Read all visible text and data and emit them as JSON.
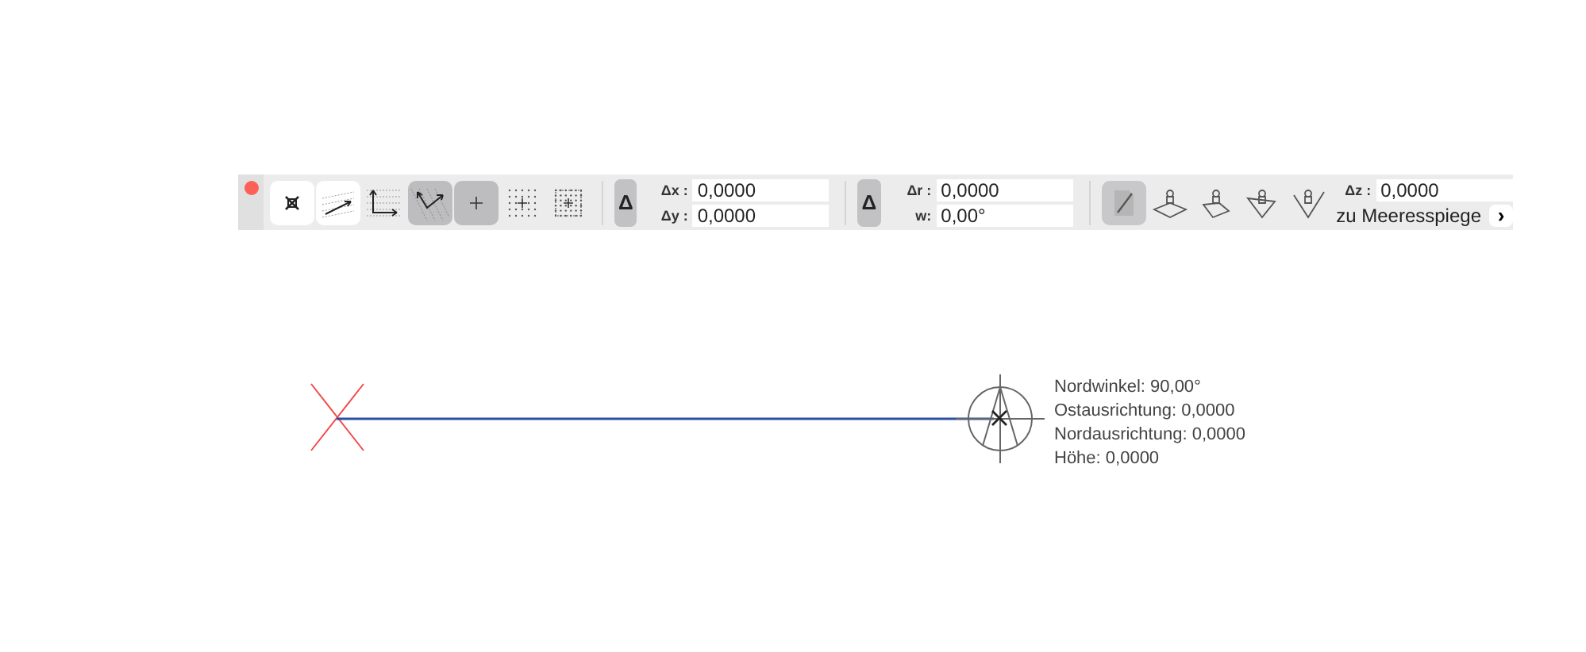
{
  "toolbar": {
    "close_button": {
      "color": "#fe5f57"
    },
    "snap_tools": [
      {
        "kind": "raised"
      },
      {
        "kind": "raised"
      },
      {
        "kind": "plain"
      },
      {
        "kind": "pressed"
      },
      {
        "kind": "pressed"
      },
      {
        "kind": "plain"
      },
      {
        "kind": "plain"
      }
    ],
    "cartesian": {
      "delta_button": "Δ",
      "fields": [
        {
          "label": "Δx :",
          "value": "0,0000"
        },
        {
          "label": "Δy :",
          "value": "0,0000"
        }
      ]
    },
    "polar": {
      "delta_button": "Δ",
      "fields": [
        {
          "label": "Δr :",
          "value": "0,0000"
        },
        {
          "label": "w:",
          "value": "0,00°"
        }
      ]
    },
    "elevation_tools": [
      {
        "selected": true
      },
      {
        "selected": false
      },
      {
        "selected": false
      },
      {
        "selected": false
      },
      {
        "selected": false
      }
    ],
    "elevation": {
      "label": "Δz :",
      "value": "0,0000",
      "reference": "zu Meeresspiege",
      "more_button": "›"
    }
  },
  "canvas": {
    "info": [
      "Nordwinkel: 90,00°",
      "Ostausrichtung: 0,0000",
      "Nordausrichtung: 0,0000",
      "Höhe: 0,0000"
    ]
  }
}
